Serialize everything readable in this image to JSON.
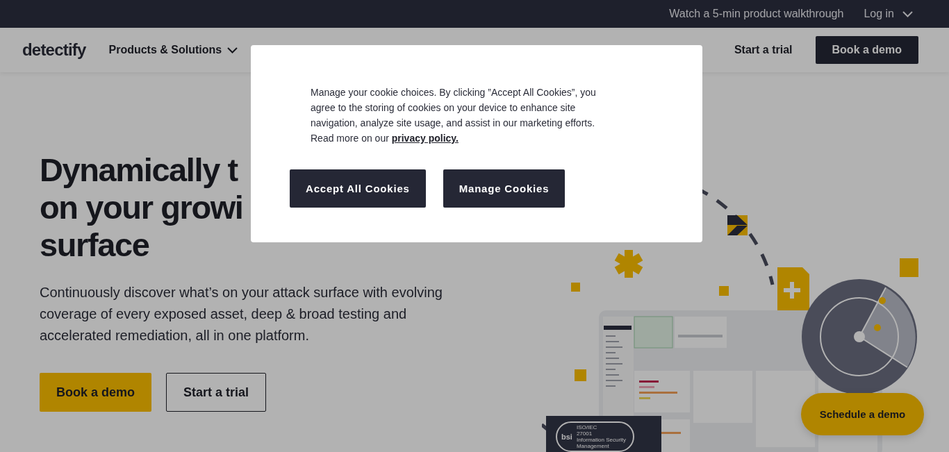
{
  "top_bar": {
    "links": [
      {
        "label": "Watch a 5-min product walkthrough",
        "dropdown": false
      },
      {
        "label": "Log in",
        "dropdown": true
      }
    ]
  },
  "nav": {
    "logo": "detectify",
    "items": [
      {
        "label": "Products & Solutions",
        "dropdown": true
      }
    ],
    "start_trial": "Start a trial",
    "book_demo": "Book a demo"
  },
  "hero": {
    "heading_lines": [
      "Dynamically t",
      "on your growi",
      "surface"
    ],
    "description": "Continuously discover what’s on your attack surface with evolving coverage of every exposed asset, deep & broad testing and accelerated remediation, all in one platform.",
    "buttons": [
      {
        "label": "Book a demo",
        "kind": "primary"
      },
      {
        "label": "Start a trial",
        "kind": "secondary"
      }
    ]
  },
  "iso_badge": {
    "org": "bsi",
    "lines": [
      "ISO/IEC",
      "27001",
      "Information Security",
      "Management"
    ]
  },
  "floating_button": "Schedule a demo",
  "cookie_dialog": {
    "text": "Manage your cookie choices. By clicking ”Accept All Cookies”, you agree to the storing of cookies on your device to enhance site navigation, analyze site usage, and assist in our marketing efforts. Read more on our",
    "link": "privacy policy.",
    "buttons": [
      {
        "label": "Accept All Cookies"
      },
      {
        "label": "Manage Cookies"
      }
    ]
  }
}
